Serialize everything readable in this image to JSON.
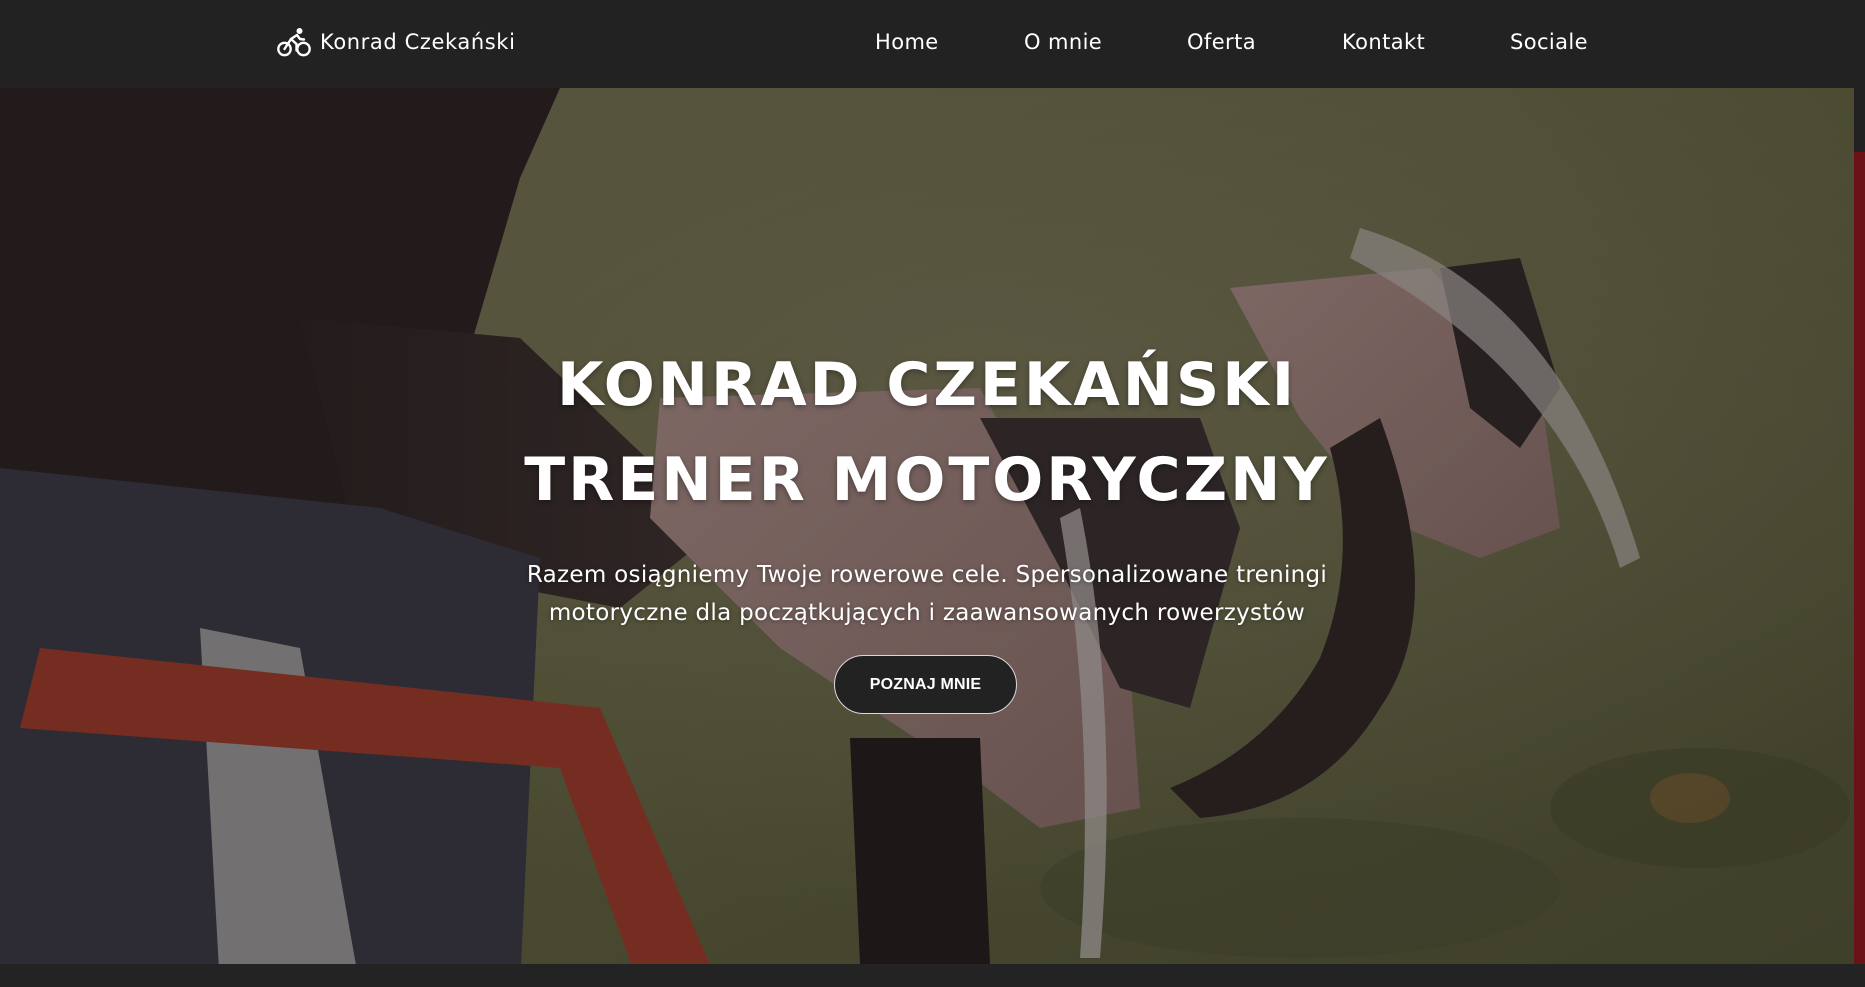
{
  "brand": {
    "name": "Konrad Czekański",
    "icon": "bicycle-rider-icon"
  },
  "nav": {
    "items": [
      {
        "label": "Home"
      },
      {
        "label": "O mnie"
      },
      {
        "label": "Oferta"
      },
      {
        "label": "Kontakt"
      },
      {
        "label": "Sociale"
      }
    ]
  },
  "hero": {
    "title_line1": "KONRAD CZEKAŃSKI",
    "title_line2": "TRENER MOTORYCZNY",
    "subtitle": "Razem osiągniemy Twoje rowerowe cele. Spersonalizowane treningi motoryczne dla początkujących i zaawansowanych rowerzystów",
    "cta_label": "POZNAJ MNIE"
  },
  "colors": {
    "navbar_bg": "#222222",
    "cta_bg": "#222222",
    "cta_border": "#d9d9d9",
    "accent_red": "#6b1216"
  }
}
